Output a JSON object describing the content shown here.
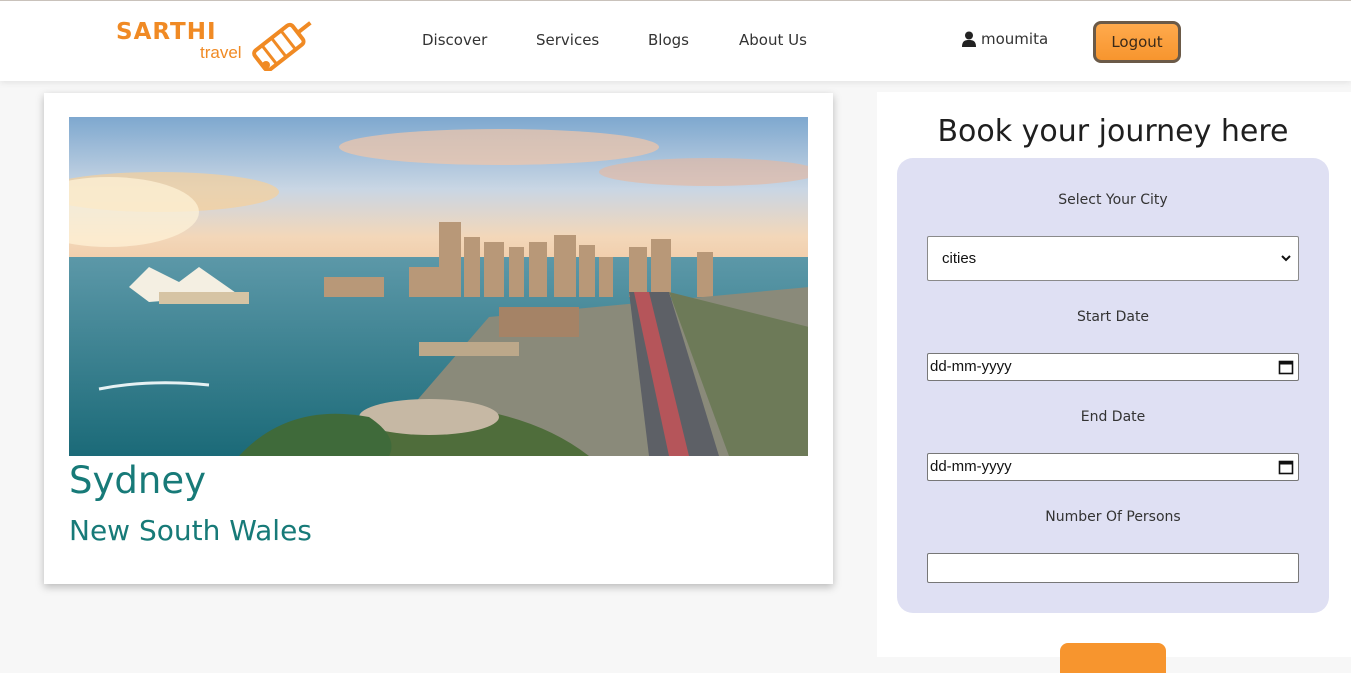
{
  "header": {
    "logo_text": "SARTHI",
    "logo_subtext": "travel",
    "nav": [
      "Discover",
      "Services",
      "Blogs",
      "About Us"
    ],
    "user_name": "moumita",
    "logout_label": "Logout"
  },
  "destination": {
    "city": "Sydney",
    "region": "New South Wales",
    "image_icon": "sydney-harbour-photo"
  },
  "booking": {
    "title": "Book your journey here",
    "city_label": "Select Your City",
    "city_value": "cities",
    "start_label": "Start Date",
    "start_value": "dd-mm-yyyy",
    "end_label": "End Date",
    "end_value": "dd-mm-yyyy",
    "persons_label": "Number Of Persons",
    "persons_value": "",
    "submit_label": ""
  },
  "colors": {
    "brand_orange": "#f08a24",
    "teal": "#177a78",
    "form_bg": "#dfe0f3"
  }
}
